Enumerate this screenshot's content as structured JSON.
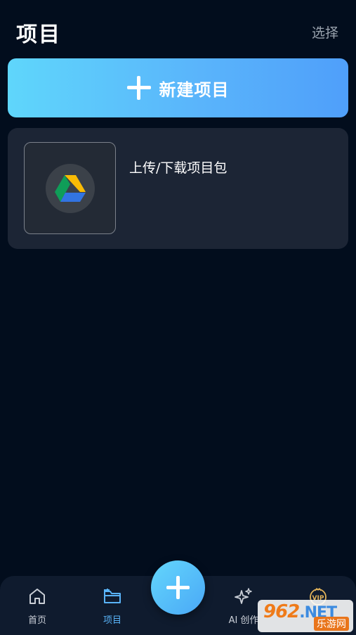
{
  "header": {
    "title": "项目",
    "select_label": "选择"
  },
  "new_project": {
    "label": "新建项目"
  },
  "upload_card": {
    "label": "上传/下载项目包"
  },
  "tabbar": {
    "tabs": [
      {
        "label": "首页",
        "icon": "home-icon",
        "active": false
      },
      {
        "label": "项目",
        "icon": "folder-icon",
        "active": true
      },
      {
        "label": "AI 创作",
        "icon": "sparkle-icon",
        "active": false
      },
      {
        "label": "",
        "icon": "vip-icon",
        "active": false
      }
    ],
    "fab_icon": "plus-icon"
  },
  "watermark": {
    "brand": "962",
    "net": ".NET",
    "sub": "乐游网"
  },
  "colors": {
    "background": "#020d1d",
    "accent": "#59b3f7",
    "card": "#1c2535"
  }
}
